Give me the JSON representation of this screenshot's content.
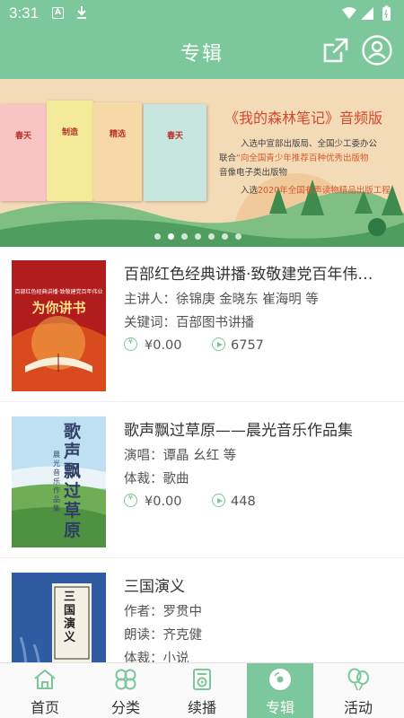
{
  "status_bar": {
    "time": "3:31",
    "a_badge": "A"
  },
  "header": {
    "title": "专辑"
  },
  "banner": {
    "title": "《我的森林笔记》音频版",
    "lines": [
      {
        "text": "入选中宣部出版局、全国少工委办公",
        "highlight": ""
      },
      {
        "text": "联合",
        "highlight": "“向全国青少年推荐百种优秀出版物"
      },
      {
        "text": "音像电子类出版物",
        "highlight": ""
      },
      {
        "text": "入选",
        "highlight": "2020年全国有声读物精品出版工程"
      }
    ],
    "book_labels": [
      "春天",
      "制造",
      "精选",
      "春天"
    ],
    "slide_count": 7,
    "active_slide": 1
  },
  "albums": [
    {
      "title": "百部红色经典讲播·致敬建党百年伟…",
      "line1": "主讲人：徐锦庚 金晓东 崔海明 等",
      "line2": "关键词：百部图书讲播",
      "price": "¥0.00",
      "plays": "6757",
      "cover_text": {
        "top": "百部红色经典讲播·致敬建党百年伟业",
        "main": "为你讲书"
      }
    },
    {
      "title": "歌声飘过草原——晨光音乐作品集",
      "line1": "演唱：谭晶 幺红 等",
      "line2": "体裁：歌曲",
      "price": "¥0.00",
      "plays": "448",
      "cover_text": {
        "main": "歌声飘过草原",
        "sub": "晨光音乐作品集"
      }
    },
    {
      "title": "三国演义",
      "line1": "作者：罗贯中",
      "line2": "朗读：齐克健",
      "line3": "体裁：小说",
      "cover_text": {
        "main": "三国演义"
      }
    }
  ],
  "bottom_nav": [
    {
      "label": "首页",
      "icon": "home-icon"
    },
    {
      "label": "分类",
      "icon": "category-icon"
    },
    {
      "label": "续播",
      "icon": "continue-play-icon"
    },
    {
      "label": "专辑",
      "icon": "album-icon",
      "active": true
    },
    {
      "label": "活动",
      "icon": "balloon-icon"
    }
  ],
  "colors": {
    "primary": "#7cc79b",
    "banner_bg": "#f4dbb8",
    "banner_title": "#d24a2e"
  }
}
